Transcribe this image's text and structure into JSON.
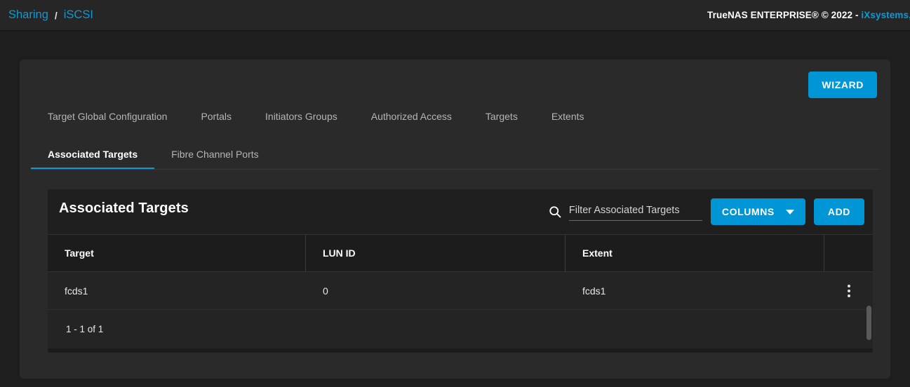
{
  "topbar": {
    "breadcrumb": {
      "parent": "Sharing",
      "separator": "/",
      "current": "iSCSI"
    },
    "copyright_main": "TrueNAS ENTERPRISE® © 2022 - ",
    "copyright_vendor": "iXsystems, In"
  },
  "page": {
    "wizard_label": "WIZARD",
    "primary_tabs": [
      {
        "label": "Target Global Configuration",
        "active": false
      },
      {
        "label": "Portals",
        "active": false
      },
      {
        "label": "Initiators Groups",
        "active": false
      },
      {
        "label": "Authorized Access",
        "active": false
      },
      {
        "label": "Targets",
        "active": false
      },
      {
        "label": "Extents",
        "active": false
      }
    ],
    "secondary_tabs": [
      {
        "label": "Associated Targets",
        "active": true
      },
      {
        "label": "Fibre Channel Ports",
        "active": false
      }
    ]
  },
  "data_card": {
    "title": "Associated Targets",
    "search": {
      "placeholder": "Filter Associated Targets",
      "value": "",
      "icon": "search-icon"
    },
    "columns_button": "COLUMNS",
    "add_button": "ADD",
    "table": {
      "headers": [
        "Target",
        "LUN ID",
        "Extent",
        ""
      ],
      "rows": [
        {
          "target": "fcds1",
          "lun_id": "0",
          "extent": "fcds1",
          "actions_icon": "kebab-menu-icon"
        }
      ],
      "footer_range": "1 - 1 of 1"
    }
  },
  "colors": {
    "accent": "#0095d5",
    "link": "#0d99d6",
    "page_bg": "#1e1e1e",
    "card_bg": "#2a2a2a",
    "table_bg": "#1c1c1c",
    "row_bg": "#242424"
  }
}
